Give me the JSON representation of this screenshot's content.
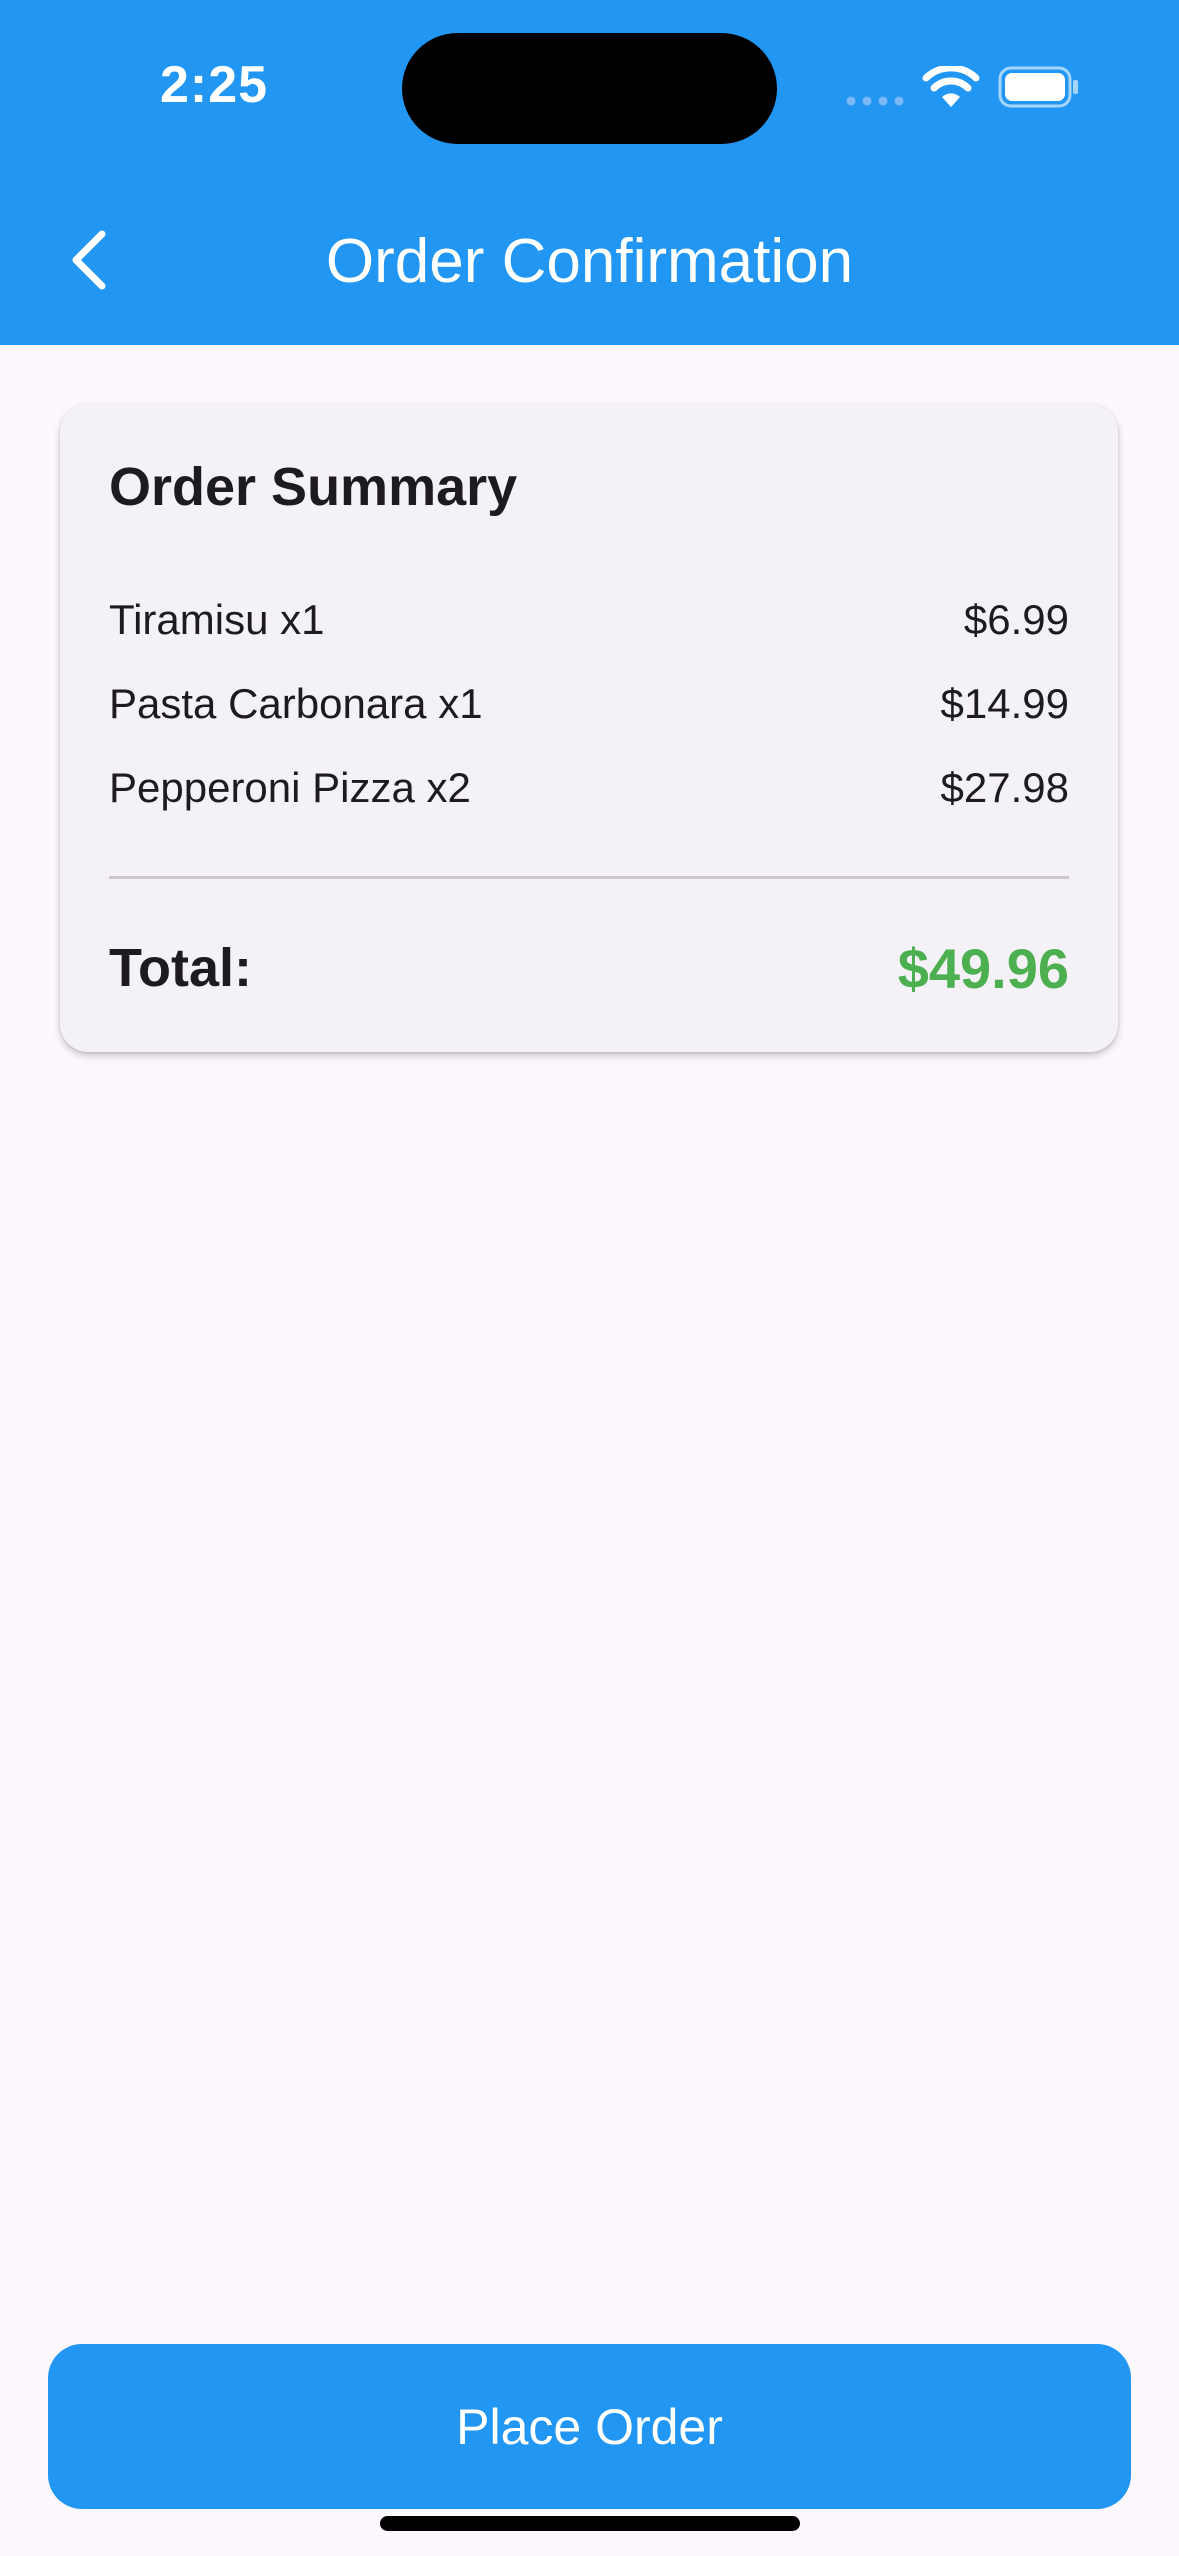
{
  "status_bar": {
    "time": "2:25"
  },
  "app_bar": {
    "title": "Order Confirmation",
    "back_icon": "chevron-left-icon",
    "background": "#2196f3"
  },
  "order_summary": {
    "title": "Order Summary",
    "items": [
      {
        "name": "Tiramisu x1",
        "price": "$6.99"
      },
      {
        "name": "Pasta Carbonara x1",
        "price": "$14.99"
      },
      {
        "name": "Pepperoni Pizza x2",
        "price": "$27.98"
      }
    ],
    "total_label": "Total:",
    "total_value": "$49.96",
    "total_color": "#4caf50"
  },
  "actions": {
    "place_order_label": "Place Order"
  }
}
